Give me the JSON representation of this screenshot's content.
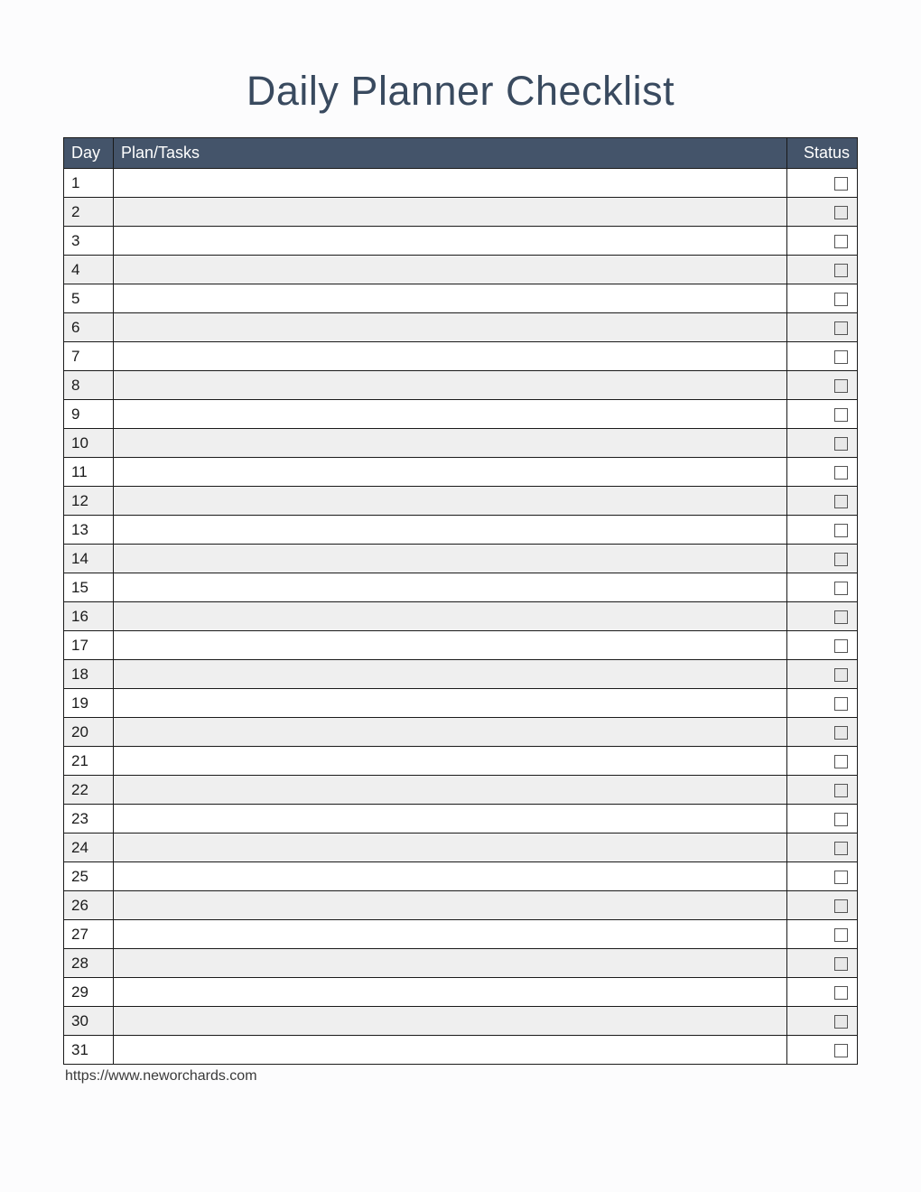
{
  "title": "Daily Planner Checklist",
  "headers": {
    "day": "Day",
    "task": "Plan/Tasks",
    "status": "Status"
  },
  "rows": [
    {
      "day": "1",
      "task": "",
      "status": false
    },
    {
      "day": "2",
      "task": "",
      "status": false
    },
    {
      "day": "3",
      "task": "",
      "status": false
    },
    {
      "day": "4",
      "task": "",
      "status": false
    },
    {
      "day": "5",
      "task": "",
      "status": false
    },
    {
      "day": "6",
      "task": "",
      "status": false
    },
    {
      "day": "7",
      "task": "",
      "status": false
    },
    {
      "day": "8",
      "task": "",
      "status": false
    },
    {
      "day": "9",
      "task": "",
      "status": false
    },
    {
      "day": "10",
      "task": "",
      "status": false
    },
    {
      "day": "11",
      "task": "",
      "status": false
    },
    {
      "day": "12",
      "task": "",
      "status": false
    },
    {
      "day": "13",
      "task": "",
      "status": false
    },
    {
      "day": "14",
      "task": "",
      "status": false
    },
    {
      "day": "15",
      "task": "",
      "status": false
    },
    {
      "day": "16",
      "task": "",
      "status": false
    },
    {
      "day": "17",
      "task": "",
      "status": false
    },
    {
      "day": "18",
      "task": "",
      "status": false
    },
    {
      "day": "19",
      "task": "",
      "status": false
    },
    {
      "day": "20",
      "task": "",
      "status": false
    },
    {
      "day": "21",
      "task": "",
      "status": false
    },
    {
      "day": "22",
      "task": "",
      "status": false
    },
    {
      "day": "23",
      "task": "",
      "status": false
    },
    {
      "day": "24",
      "task": "",
      "status": false
    },
    {
      "day": "25",
      "task": "",
      "status": false
    },
    {
      "day": "26",
      "task": "",
      "status": false
    },
    {
      "day": "27",
      "task": "",
      "status": false
    },
    {
      "day": "28",
      "task": "",
      "status": false
    },
    {
      "day": "29",
      "task": "",
      "status": false
    },
    {
      "day": "30",
      "task": "",
      "status": false
    },
    {
      "day": "31",
      "task": "",
      "status": false
    }
  ],
  "footer_url": "https://www.neworchards.com"
}
